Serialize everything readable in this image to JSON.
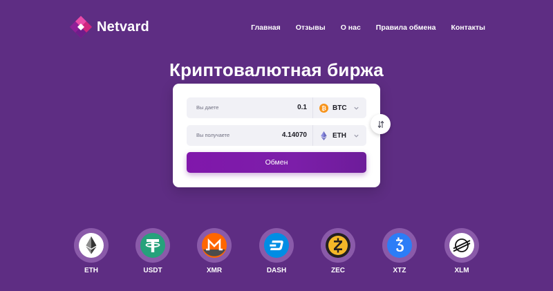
{
  "brand": {
    "name": "Netvard",
    "logo": "netvard-logo",
    "colors": {
      "background": "#5e2d83",
      "accent": "#8017ab"
    }
  },
  "nav": {
    "items": [
      "Главная",
      "Отзывы",
      "О нас",
      "Правила обмена",
      "Контакты"
    ]
  },
  "hero": {
    "title": "Криптовалютная биржа"
  },
  "exchange": {
    "give": {
      "label": "Вы даете",
      "value": "0.1",
      "currency": "BTC",
      "icon": "bitcoin-icon"
    },
    "get": {
      "label": "Вы получаете",
      "value": "4.14070",
      "currency": "ETH",
      "icon": "ethereum-icon"
    },
    "button_label": "Обмен",
    "swap_icon": "swap-arrows-icon"
  },
  "coins": [
    {
      "label": "ETH",
      "icon": "ethereum-icon"
    },
    {
      "label": "USDT",
      "icon": "tether-icon"
    },
    {
      "label": "XMR",
      "icon": "monero-icon"
    },
    {
      "label": "DASH",
      "icon": "dash-icon"
    },
    {
      "label": "ZEC",
      "icon": "zcash-icon"
    },
    {
      "label": "XTZ",
      "icon": "tezos-icon"
    },
    {
      "label": "XLM",
      "icon": "stellar-icon"
    }
  ]
}
